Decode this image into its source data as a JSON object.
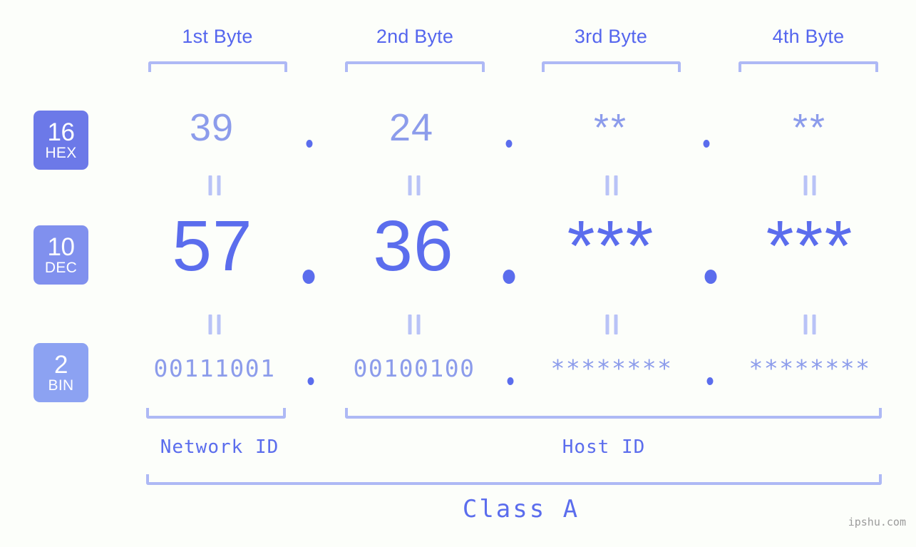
{
  "meta": {
    "background_color": "#fcfefa",
    "accent_color": "#5b6ded",
    "accent_light": "#8c9ceb",
    "bracket_color": "#aeb9f5"
  },
  "byte_headers": [
    {
      "label": "1st Byte"
    },
    {
      "label": "2nd Byte"
    },
    {
      "label": "3rd Byte"
    },
    {
      "label": "4th Byte"
    }
  ],
  "rows": [
    {
      "radix": "16",
      "radix_name": "HEX",
      "badge_color": "#6c79e8",
      "values": [
        "39",
        "24",
        "**",
        "**"
      ]
    },
    {
      "radix": "10",
      "radix_name": "DEC",
      "badge_color": "#8090ee",
      "values": [
        "57",
        "36",
        "***",
        "***"
      ]
    },
    {
      "radix": "2",
      "radix_name": "BIN",
      "badge_color": "#8ca2f2",
      "values": [
        "00111001",
        "00100100",
        "********",
        "********"
      ]
    }
  ],
  "separators": {
    "dot": ".",
    "equals": "||"
  },
  "id_sections": [
    {
      "label": "Network ID"
    },
    {
      "label": "Host ID"
    }
  ],
  "class": {
    "label": "Class A"
  },
  "watermark": {
    "text": "ipshu.com"
  }
}
